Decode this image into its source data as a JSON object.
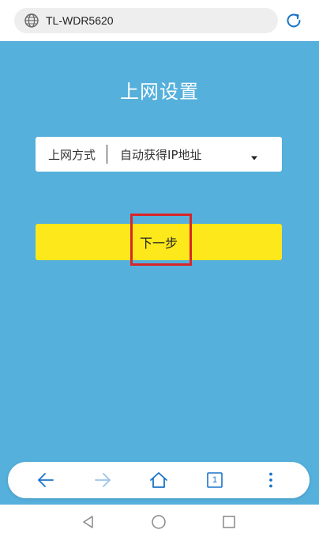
{
  "browser": {
    "url": "TL-WDR5620",
    "icons": {
      "site": "globe-icon",
      "refresh": "refresh-icon"
    }
  },
  "page": {
    "title": "上网设置",
    "connection": {
      "label": "上网方式",
      "selected": "自动获得IP地址"
    },
    "next_label": "下一步",
    "colors": {
      "background": "#55b0dc",
      "button": "#fde81c",
      "highlight": "#d92526"
    }
  },
  "toolbar": {
    "tabs_count": "1",
    "icons": [
      "back-arrow-icon",
      "forward-arrow-icon",
      "home-icon",
      "tabs-icon",
      "more-vertical-icon"
    ]
  },
  "system_nav": {
    "icons": [
      "back-triangle-icon",
      "home-circle-icon",
      "recents-square-icon"
    ]
  }
}
